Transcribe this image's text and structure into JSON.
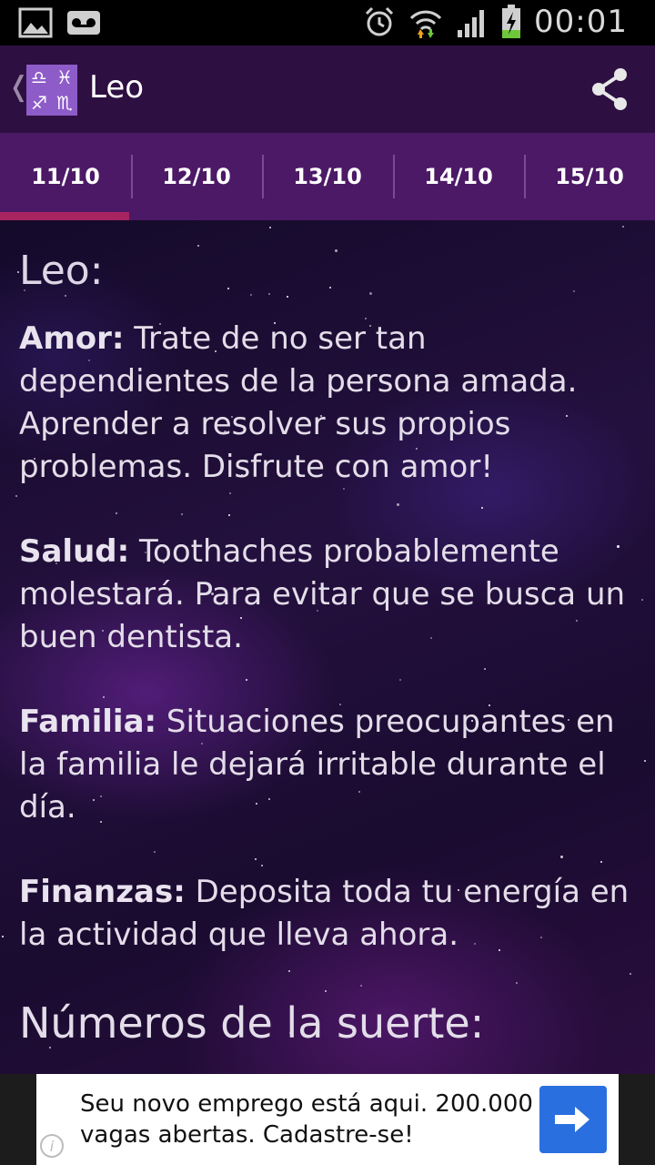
{
  "status_bar": {
    "time": "00:01",
    "icons": [
      "image-icon",
      "voicemail-icon",
      "alarm-icon",
      "wifi-icon",
      "signal-icon",
      "battery-charging-icon"
    ]
  },
  "action_bar": {
    "title": "Leo",
    "icons": [
      "zodiac-app-icon",
      "share-icon"
    ]
  },
  "tabs": [
    {
      "label": "11/10",
      "active": true
    },
    {
      "label": "12/10",
      "active": false
    },
    {
      "label": "13/10",
      "active": false
    },
    {
      "label": "14/10",
      "active": false
    },
    {
      "label": "15/10",
      "active": false
    }
  ],
  "horoscope": {
    "heading": "Leo:",
    "sections": [
      {
        "label": "Amor:",
        "text": " Trate de no ser tan dependientes de la persona amada. Aprender a resolver sus propios problemas. Disfrute con amor!"
      },
      {
        "label": "Salud:",
        "text": " Toothaches probablemente molestará. Para evitar que se busca un buen dentista."
      },
      {
        "label": "Familia:",
        "text": " Situaciones preocupantes en la familia le dejará irritable durante el día."
      },
      {
        "label": "Finanzas:",
        "text": " Deposita toda tu energía en la actividad que lleva ahora."
      }
    ],
    "lucky_heading": "Números de la suerte:"
  },
  "ad": {
    "text": "Seu novo emprego está aqui. 200.000 vagas abertas. Cadastre-se!",
    "info_glyph": "i",
    "accent_color": "#2a6fe0"
  },
  "colors": {
    "action_bar": "#2e0f42",
    "tab_strip": "#4c1966",
    "tab_indicator": "#a6245f"
  }
}
